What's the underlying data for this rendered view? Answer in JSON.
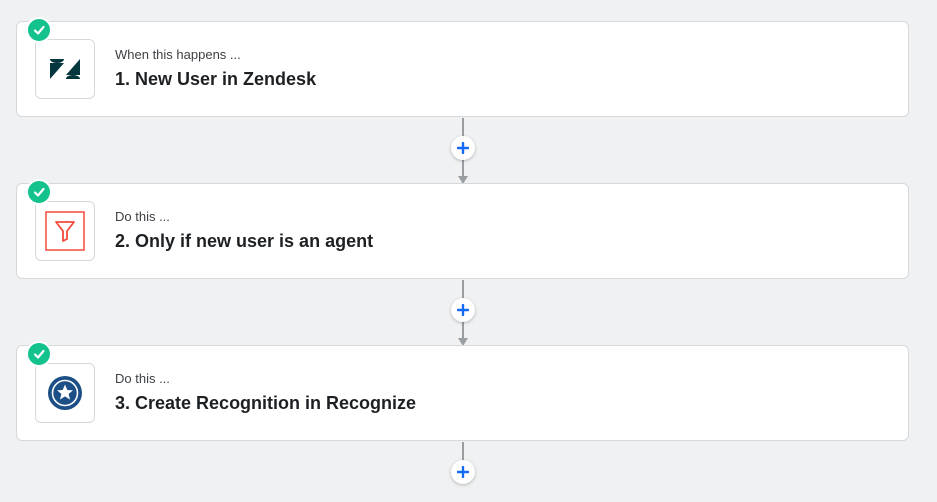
{
  "colors": {
    "background": "#eff1f2",
    "check": "#13c28d",
    "plus": "#136bf5",
    "filter": "#f34a3b",
    "zendesk": "#03363d",
    "recognize": "#1c4f86"
  },
  "steps": [
    {
      "label": "When this happens ...",
      "title": "1. New User in Zendesk",
      "icon": "zendesk-icon",
      "status": "complete"
    },
    {
      "label": "Do this ...",
      "title": "2. Only if new user is an agent",
      "icon": "filter-icon",
      "status": "complete"
    },
    {
      "label": "Do this ...",
      "title": "3. Create Recognition in Recognize",
      "icon": "recognize-star-icon",
      "status": "complete"
    }
  ],
  "add_step_icon": "plus-icon"
}
